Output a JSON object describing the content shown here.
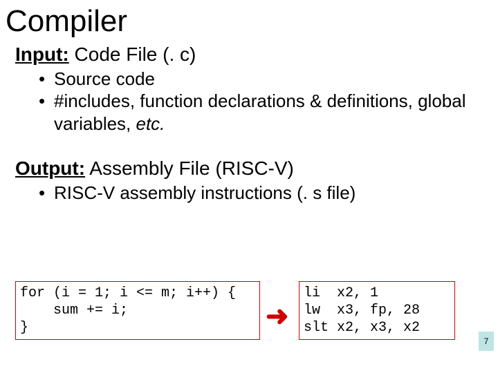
{
  "title": "Compiler",
  "input": {
    "label": "Input:",
    "text": " Code File (. c)",
    "bullets": [
      "Source code",
      "#includes, function declarations & definitions, global variables, "
    ],
    "bullet2_tail": "etc."
  },
  "output": {
    "label": "Output:",
    "text": "  Assembly File (RISC-V)",
    "bullets": [
      "RISC-V assembly instructions (. s file)"
    ]
  },
  "code_before": "for (i = 1; i <= m; i++) {\n    sum += i;\n}",
  "code_after": "li  x2, 1\nlw  x3, fp, 28\nslt x2, x3, x2",
  "arrow": "➜",
  "page": "7"
}
